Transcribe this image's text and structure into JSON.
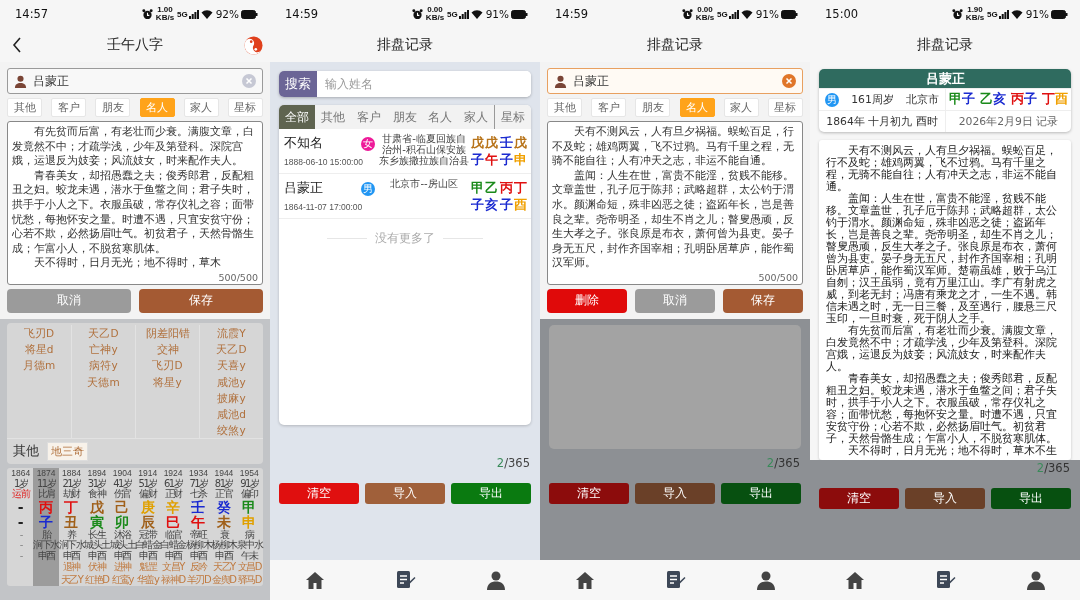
{
  "screens": [
    {
      "kind": "chart",
      "dimmed": true,
      "status_bar": {
        "time": "14:57",
        "net_speed": "1.00 KB/s",
        "network": "5G",
        "battery": "92%"
      },
      "title": "壬午八字",
      "editor": {
        "name": "吕蒙正",
        "focused": false,
        "tags": [
          {
            "label": "其他",
            "selected": false
          },
          {
            "label": "客户",
            "selected": false
          },
          {
            "label": "朋友",
            "selected": false
          },
          {
            "label": "名人",
            "selected": true
          },
          {
            "label": "家人",
            "selected": false
          },
          {
            "label": "星标",
            "selected": false
          }
        ],
        "paragraphs": [
          "有先贫而后富，有老壮而少衰。满腹文章，白发竟然不中；才疏学浅，少年及第登科。深院宫娥，运退反为妓妾；风流妓女，时来配作夫人。",
          "青春美女，却招愚蠢之夫；俊秀郎君，反配粗丑之妇。蛟龙未遇，潜水于鱼鳖之间；君子失时，拱手于小人之下。衣服虽破，常存仪礼之容；面带忧愁，每抱怀安之量。时遭不遇，只宜安贫守份；心若不欺，必然扬眉吐气。初贫君子，天然骨骼生成；乍富小人，不脱贫寒肌体。",
          "天不得时，日月无光；地不得时，草木"
        ],
        "counter": "500/500",
        "buttons": [
          {
            "label": "取消",
            "kind": "cancel"
          },
          {
            "label": "保存",
            "kind": "save"
          }
        ]
      },
      "shensha": {
        "columns": [
          [
            "飞刃D",
            "将星d",
            "月德m"
          ],
          [
            "天乙D",
            "亡神y",
            "病符y",
            "天德m"
          ],
          [
            "阴差阳错",
            "交神",
            "飞刃D",
            "将星y"
          ],
          [
            "流霞Y",
            "天乙D",
            "天喜y",
            "咸池y",
            "披麻y",
            "咸池d",
            "绞煞y"
          ]
        ],
        "other_label": "其他",
        "other_tags": [
          "地三奇"
        ]
      },
      "dayun": [
        {
          "kind": "pre",
          "selected": false,
          "year": "1864",
          "age": "1岁",
          "ten_god": "运前",
          "gan": {
            "char": "-"
          },
          "zhi": {
            "char": "-"
          },
          "stage": "-",
          "nayin": "-",
          "void": "-"
        },
        {
          "kind": "luck",
          "selected": true,
          "year": "1874",
          "age": "11岁",
          "ten_god": "比肩",
          "gan": {
            "char": "丙",
            "color": "#e01010"
          },
          "zhi": {
            "char": "子",
            "color": "#1a2ad0"
          },
          "stage": "胎",
          "nayin": "涧下水",
          "void": "申酉"
        },
        {
          "kind": "luck",
          "selected": false,
          "year": "1884",
          "age": "21岁",
          "ten_god": "劫财",
          "gan": {
            "char": "丁",
            "color": "#e01010"
          },
          "zhi": {
            "char": "丑",
            "color": "#a0601a"
          },
          "stage": "养",
          "nayin": "涧下水",
          "void": "申酉",
          "stars": [
            "退神",
            "天乙Y"
          ]
        },
        {
          "kind": "luck",
          "selected": false,
          "year": "1894",
          "age": "31岁",
          "ten_god": "食神",
          "gan": {
            "char": "戊",
            "color": "#a0601a"
          },
          "zhi": {
            "char": "寅",
            "color": "#1a8a1a"
          },
          "stage": "长生",
          "nayin": "城头土",
          "void": "申酉",
          "stars": [
            "伏神",
            "红艳D"
          ]
        },
        {
          "kind": "luck",
          "selected": false,
          "year": "1904",
          "age": "41岁",
          "ten_god": "伤官",
          "gan": {
            "char": "己",
            "color": "#a0601a"
          },
          "zhi": {
            "char": "卯",
            "color": "#1a8a1a"
          },
          "stage": "沐浴",
          "nayin": "城头土",
          "void": "申酉",
          "stars": [
            "进神",
            "红鸾y"
          ]
        },
        {
          "kind": "luck",
          "selected": false,
          "year": "1914",
          "age": "51岁",
          "ten_god": "偏财",
          "gan": {
            "char": "庚",
            "color": "#e0a000"
          },
          "zhi": {
            "char": "辰",
            "color": "#a0601a"
          },
          "stage": "冠带",
          "nayin": "白蜡金",
          "void": "申酉",
          "stars": [
            "魁罡",
            "华盖y"
          ]
        },
        {
          "kind": "luck",
          "selected": false,
          "year": "1924",
          "age": "61岁",
          "ten_god": "正财",
          "gan": {
            "char": "辛",
            "color": "#e0a000"
          },
          "zhi": {
            "char": "巳",
            "color": "#e01010"
          },
          "stage": "临官",
          "nayin": "白蜡金",
          "void": "申酉",
          "stars": [
            "文昌Y",
            "禄神D"
          ]
        },
        {
          "kind": "luck",
          "selected": false,
          "year": "1934",
          "age": "71岁",
          "ten_god": "七杀",
          "gan": {
            "char": "壬",
            "color": "#1a2ad0"
          },
          "zhi": {
            "char": "午",
            "color": "#e01010"
          },
          "stage": "帝旺",
          "nayin": "杨柳木",
          "void": "申酉",
          "stars": [
            "反吟",
            "羊刃D"
          ]
        },
        {
          "kind": "luck",
          "selected": false,
          "year": "1944",
          "age": "81岁",
          "ten_god": "正官",
          "gan": {
            "char": "癸",
            "color": "#1a2ad0"
          },
          "zhi": {
            "char": "未",
            "color": "#a0601a"
          },
          "stage": "衰",
          "nayin": "杨柳木",
          "void": "申酉",
          "stars": [
            "天乙Y",
            "金舆D"
          ]
        },
        {
          "kind": "luck",
          "selected": false,
          "year": "1954",
          "age": "91岁",
          "ten_god": "偏印",
          "gan": {
            "char": "甲",
            "color": "#1a8a1a"
          },
          "zhi": {
            "char": "申",
            "color": "#e0a000"
          },
          "stage": "病",
          "nayin": "泉中水",
          "void": "午未",
          "stars": [
            "文昌D",
            "驿马D"
          ]
        }
      ]
    },
    {
      "kind": "records",
      "dimmed": false,
      "status_bar": {
        "time": "14:59",
        "net_speed": "0.00 KB/s",
        "network": "5G",
        "battery": "91%"
      },
      "title": "排盘记录",
      "search": {
        "button": "搜索",
        "placeholder": "输入姓名"
      },
      "filters": [
        {
          "label": "全部",
          "selected": true
        },
        {
          "label": "其他",
          "selected": false
        },
        {
          "label": "客户",
          "selected": false
        },
        {
          "label": "朋友",
          "selected": false
        },
        {
          "label": "名人",
          "selected": false
        },
        {
          "label": "家人",
          "selected": false
        },
        {
          "label": "星标",
          "selected": false
        }
      ],
      "records": [
        {
          "name": "不知名",
          "gender": {
            "label": "女",
            "kind": "female"
          },
          "datetime": "1888-06-10 15:00:00",
          "place": "甘肃省-临夏回族自治州-积石山保安族东乡族撒拉族自治县",
          "stems": [
            {
              "char": "戊",
              "color": "#b8741a"
            },
            {
              "char": "戊",
              "color": "#b8741a"
            },
            {
              "char": "壬",
              "color": "#1a2ad0"
            },
            {
              "char": "戊",
              "color": "#b8741a"
            }
          ],
          "branches": [
            {
              "char": "子",
              "color": "#1a2ad0"
            },
            {
              "char": "午",
              "color": "#e01010"
            },
            {
              "char": "子",
              "color": "#1a2ad0"
            },
            {
              "char": "申",
              "color": "#f0a000"
            }
          ]
        },
        {
          "name": "吕蒙正",
          "gender": {
            "label": "男",
            "kind": "male"
          },
          "datetime": "1864-11-07 17:00:00",
          "place": "北京市--房山区",
          "stems": [
            {
              "char": "甲",
              "color": "#1a8a1a"
            },
            {
              "char": "乙",
              "color": "#1a8a1a"
            },
            {
              "char": "丙",
              "color": "#e01010"
            },
            {
              "char": "丁",
              "color": "#e01010"
            }
          ],
          "branches": [
            {
              "char": "子",
              "color": "#1a2ad0"
            },
            {
              "char": "亥",
              "color": "#1a2ad0"
            },
            {
              "char": "子",
              "color": "#1a2ad0"
            },
            {
              "char": "酉",
              "color": "#f0a000"
            }
          ]
        }
      ],
      "end_note": "没有更多了",
      "count": {
        "current": "2",
        "total": "/365"
      },
      "actions": [
        {
          "label": "清空",
          "kind": "clear"
        },
        {
          "label": "导入",
          "kind": "import"
        },
        {
          "label": "导出",
          "kind": "export"
        }
      ]
    },
    {
      "kind": "records",
      "dimmed": true,
      "status_bar": {
        "time": "14:59",
        "net_speed": "0.00 KB/s",
        "network": "5G",
        "battery": "91%"
      },
      "title": "排盘记录",
      "editor": {
        "name": "吕蒙正",
        "focused": true,
        "tags": [
          {
            "label": "其他",
            "selected": false
          },
          {
            "label": "客户",
            "selected": false
          },
          {
            "label": "朋友",
            "selected": false
          },
          {
            "label": "名人",
            "selected": true
          },
          {
            "label": "家人",
            "selected": false
          },
          {
            "label": "星标",
            "selected": false
          }
        ],
        "paragraphs": [
          "天有不测风云，人有旦夕祸福。蜈蚣百足，行不及蛇；雄鸡两翼，飞不过鸦。马有千里之程，无骑不能自往；人有冲天之志，非运不能自通。",
          "盖闻：人生在世，富贵不能淫，贫贱不能移。文章盖世，孔子厄于陈邦；武略超群，太公钓于渭水。颜渊命短，殊非凶恶之徒；盗跖年长，岂是善良之辈。尧帝明圣，却生不肖之儿；瞽叟愚顽，反生大孝之子。张良原是布衣，萧何曾为县吏。晏子身无五尺，封作齐国宰相；孔明卧居草庐，能作蜀汉军师。"
        ],
        "counter": "500/500",
        "buttons": [
          {
            "label": "删除",
            "kind": "delete"
          },
          {
            "label": "取消",
            "kind": "cancel"
          },
          {
            "label": "保存",
            "kind": "save"
          }
        ]
      },
      "count": {
        "current": "2",
        "total": "/365"
      },
      "actions": [
        {
          "label": "清空",
          "kind": "clear"
        },
        {
          "label": "导入",
          "kind": "import"
        },
        {
          "label": "导出",
          "kind": "export"
        }
      ]
    },
    {
      "kind": "detail",
      "dimmed": true,
      "status_bar": {
        "time": "15:00",
        "net_speed": "1.90 KB/s",
        "network": "5G",
        "battery": "91%"
      },
      "title": "排盘记录",
      "detail": {
        "name": "吕蒙正",
        "gender": {
          "label": "男",
          "kind": "male"
        },
        "age": "161周岁",
        "place": "北京市",
        "pillars": [
          {
            "stem": {
              "char": "甲",
              "color": "#1a8a1a"
            },
            "branch": {
              "char": "子",
              "color": "#1a2ad0"
            }
          },
          {
            "stem": {
              "char": "乙",
              "color": "#1a8a1a"
            },
            "branch": {
              "char": "亥",
              "color": "#1a2ad0"
            }
          },
          {
            "stem": {
              "char": "丙",
              "color": "#e01010"
            },
            "branch": {
              "char": "子",
              "color": "#1a2ad0"
            }
          },
          {
            "stem": {
              "char": "丁",
              "color": "#e01010"
            },
            "branch": {
              "char": "酉",
              "color": "#f0a000"
            }
          }
        ],
        "lunar_date": "1864年 十月初九 酉时",
        "recorded": "2026年2月9日 记录"
      },
      "story": [
        "天有不测风云，人有旦夕祸福。蜈蚣百足，行不及蛇；雄鸡两翼，飞不过鸦。马有千里之程，无骑不能自往；人有冲天之志，非运不能自通。",
        "盖闻：人生在世，富贵不能淫，贫贱不能移。文章盖世，孔子厄于陈邦；武略超群，太公钓于渭水。颜渊命短，殊非凶恶之徒；盗跖年长，岂是善良之辈。尧帝明圣，却生不肖之儿；瞽叟愚顽，反生大孝之子。张良原是布衣，萧何曾为县吏。晏子身无五尺，封作齐国宰相；孔明卧居草庐，能作蜀汉军师。楚霸虽雄，败于乌江自刎；汉王虽弱，竟有万里江山。李广有射虎之威，到老无封；冯唐有乘龙之才，一生不遇。韩信未遇之时，无一日三餐，及至遇行，腰悬三尺玉印，一旦时衰，死于阴人之手。",
        "有先贫而后富，有老壮而少衰。满腹文章，白发竟然不中；才疏学浅，少年及第登科。深院宫娥，运退反为妓妾；风流妓女，时来配作夫人。",
        "青春美女，却招愚蠢之夫；俊秀郎君，反配粗丑之妇。蛟龙未遇，潜水于鱼鳖之间；君子失时，拱手于小人之下。衣服虽破，常存仪礼之容；面带忧愁，每抱怀安之量。时遭不遇，只宜安贫守份；心若不欺，必然扬眉吐气。初贫君子，天然骨骼生成；乍富小人，不脱贫寒肌体。",
        "天不得时，日月无光；地不得时，草木不生"
      ],
      "count": {
        "current": "2",
        "total": "/365"
      },
      "actions": [
        {
          "label": "清空",
          "kind": "clear"
        },
        {
          "label": "导入",
          "kind": "import"
        },
        {
          "label": "导出",
          "kind": "export"
        }
      ]
    }
  ]
}
